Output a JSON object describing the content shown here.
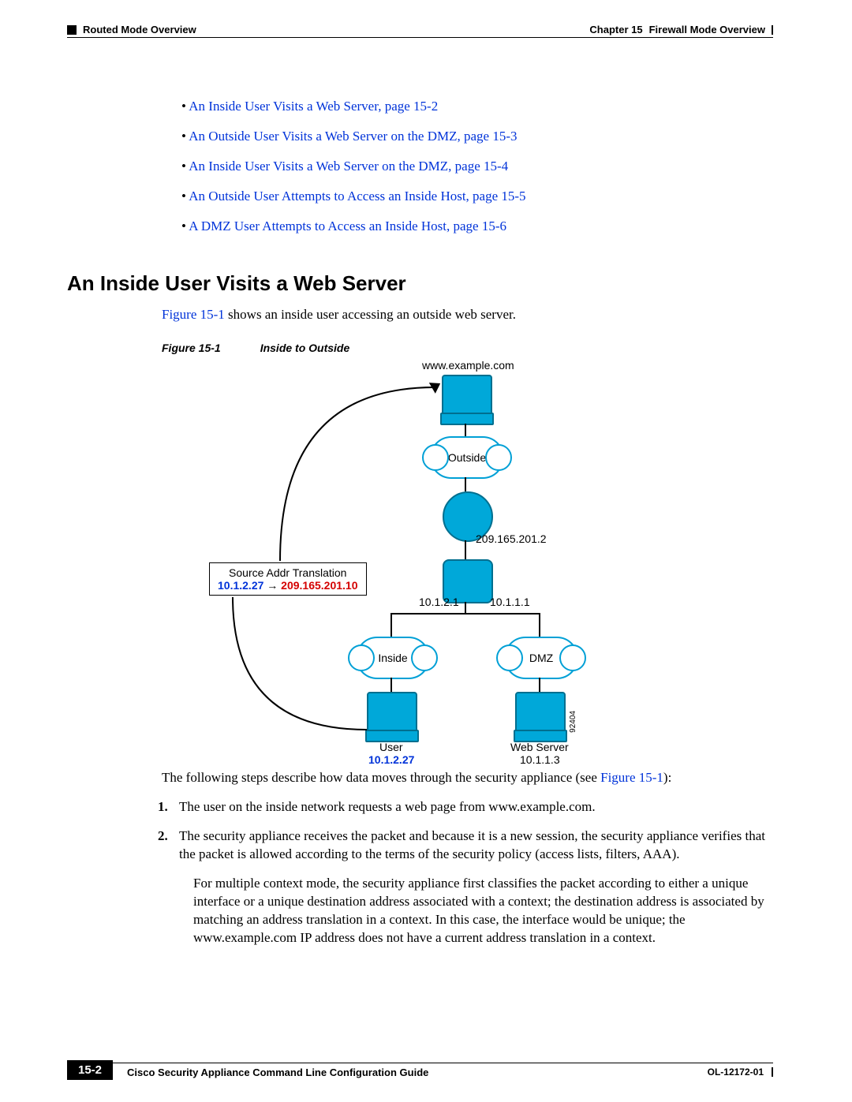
{
  "header": {
    "left": "Routed Mode Overview",
    "right_chapter": "Chapter 15",
    "right_title": "Firewall Mode Overview"
  },
  "toc": {
    "items": [
      "An Inside User Visits a Web Server, page 15-2",
      "An Outside User Visits a Web Server on the DMZ, page 15-3",
      "An Inside User Visits a Web Server on the DMZ, page 15-4",
      "An Outside User Attempts to Access an Inside Host, page 15-5",
      "A DMZ User Attempts to Access an Inside Host, page 15-6"
    ]
  },
  "section": {
    "title": "An Inside User Visits a Web Server",
    "intro_prefix": "Figure 15-1",
    "intro_suffix": " shows an inside user accessing an outside web server."
  },
  "figure": {
    "label": "Figure 15-1",
    "caption": "Inside to Outside",
    "top_host": "www.example.com",
    "outside_cloud": "Outside",
    "asa_ip": "209.165.201.2",
    "asa_left_ip": "10.1.2.1",
    "asa_right_ip": "10.1.1.1",
    "inside_cloud": "Inside",
    "dmz_cloud": "DMZ",
    "nat_title": "Source Addr Translation",
    "nat_from": "10.1.2.27",
    "nat_arrow": "→",
    "nat_to": "209.165.201.10",
    "user_label": "User",
    "user_ip": "10.1.2.27",
    "server_label": "Web Server",
    "server_ip": "10.1.1.3",
    "diagram_id": "92404"
  },
  "body": {
    "intro": "The following steps describe how data moves through the security appliance (see ",
    "intro_ref": "Figure 15-1",
    "intro_end": "):",
    "steps": [
      "The user on the inside network requests a web page from www.example.com.",
      "The security appliance receives the packet and because it is a new session, the security appliance verifies that the packet is allowed according to the terms of the security policy (access lists, filters, AAA)."
    ],
    "step2_extra": "For multiple context mode, the security appliance first classifies the packet according to either a unique interface or a unique destination address associated with a context; the destination address is associated by matching an address translation in a context. In this case, the interface would be unique; the www.example.com IP address does not have a current address translation in a context."
  },
  "footer": {
    "page_num": "15-2",
    "guide_title": "Cisco Security Appliance Command Line Configuration Guide",
    "doc_code": "OL-12172-01"
  }
}
